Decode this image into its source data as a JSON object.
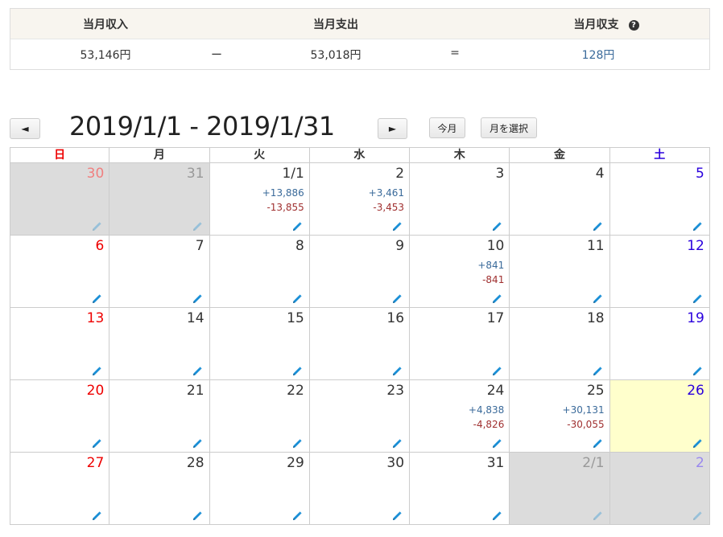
{
  "summary": {
    "income_label": "当月収入",
    "expense_label": "当月支出",
    "balance_label": "当月収支",
    "help_glyph": "?",
    "income_value": "53,146円",
    "minus": "ー",
    "expense_value": "53,018円",
    "equals": "=",
    "balance_value": "128円"
  },
  "toolbar": {
    "prev": "◄",
    "range": "2019/1/1 - 2019/1/31",
    "next": "►",
    "this_month": "今月",
    "choose_month": "月を選択"
  },
  "weekdays": [
    "日",
    "月",
    "火",
    "水",
    "木",
    "金",
    "土"
  ],
  "weeks": [
    [
      {
        "n": "30",
        "other": true
      },
      {
        "n": "31",
        "other": true
      },
      {
        "n": "1/1",
        "inc": "+13,886",
        "exp": "-13,855"
      },
      {
        "n": "2",
        "inc": "+3,461",
        "exp": "-3,453"
      },
      {
        "n": "3"
      },
      {
        "n": "4"
      },
      {
        "n": "5"
      }
    ],
    [
      {
        "n": "6"
      },
      {
        "n": "7"
      },
      {
        "n": "8"
      },
      {
        "n": "9"
      },
      {
        "n": "10",
        "inc": "+841",
        "exp": "-841"
      },
      {
        "n": "11"
      },
      {
        "n": "12"
      }
    ],
    [
      {
        "n": "13"
      },
      {
        "n": "14"
      },
      {
        "n": "15"
      },
      {
        "n": "16"
      },
      {
        "n": "17"
      },
      {
        "n": "18"
      },
      {
        "n": "19"
      }
    ],
    [
      {
        "n": "20"
      },
      {
        "n": "21"
      },
      {
        "n": "22"
      },
      {
        "n": "23"
      },
      {
        "n": "24",
        "inc": "+4,838",
        "exp": "-4,826"
      },
      {
        "n": "25",
        "inc": "+30,131",
        "exp": "-30,055"
      },
      {
        "n": "26",
        "today": true
      }
    ],
    [
      {
        "n": "27"
      },
      {
        "n": "28"
      },
      {
        "n": "29"
      },
      {
        "n": "30"
      },
      {
        "n": "31"
      },
      {
        "n": "2/1",
        "other": true
      },
      {
        "n": "2",
        "other": true
      }
    ]
  ],
  "colors": {
    "income": "#3a6a9a",
    "expense": "#a03030",
    "sunday": "#ee0000",
    "saturday": "#2a00dd",
    "today_bg": "#ffffcc",
    "other_month_bg": "#dcdcdc",
    "pencil": "#1a8fd6"
  },
  "icons": {
    "edit": "pencil-icon",
    "help": "question-circle-icon"
  }
}
